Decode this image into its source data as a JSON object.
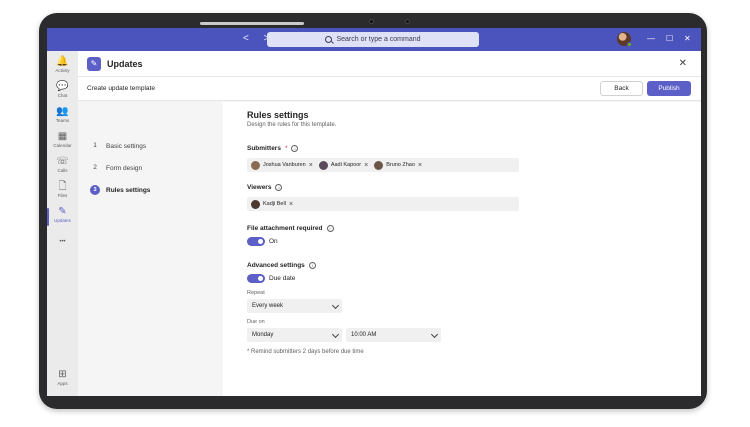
{
  "titlebar": {
    "search_placeholder": "Search or type a command",
    "nav_arrows": "< >",
    "minimize": "—",
    "maximize": "☐",
    "close": "✕"
  },
  "rail": {
    "items": [
      {
        "label": "Activity",
        "icon": "bell-icon",
        "glyph": "🔔"
      },
      {
        "label": "Chat",
        "icon": "chat-icon",
        "glyph": "💬"
      },
      {
        "label": "Teams",
        "icon": "teams-icon",
        "glyph": "👥"
      },
      {
        "label": "Calendar",
        "icon": "calendar-icon",
        "glyph": "▦"
      },
      {
        "label": "Calls",
        "icon": "phone-icon",
        "glyph": "☏"
      },
      {
        "label": "Files",
        "icon": "file-icon",
        "glyph": "🗋"
      },
      {
        "label": "Updates",
        "icon": "updates-icon",
        "glyph": "✎"
      },
      {
        "label": "",
        "icon": "more-icon",
        "glyph": "•••"
      },
      {
        "label": "Apps",
        "icon": "apps-icon",
        "glyph": "⊞"
      }
    ]
  },
  "app": {
    "title": "Updates",
    "close": "✕",
    "icon": "updates-icon"
  },
  "subheader": {
    "title": "Create update template",
    "back_label": "Back",
    "publish_label": "Publish"
  },
  "steps": [
    {
      "num": "1",
      "label": "Basic settings"
    },
    {
      "num": "2",
      "label": "Form design"
    },
    {
      "num": "3",
      "label": "Rules settings"
    }
  ],
  "main": {
    "title": "Rules settings",
    "description": "Design the rules for this template.",
    "submitters_label": "Submitters",
    "required_mark": "*",
    "submitters": [
      {
        "name": "Joshua Vanburen",
        "color": "#8a6a52"
      },
      {
        "name": "Aadi Kapoor",
        "color": "#5a4a5a"
      },
      {
        "name": "Bruno Zhao",
        "color": "#6b5548"
      }
    ],
    "viewers_label": "Viewers",
    "viewers": [
      {
        "name": "Kadji Bell",
        "color": "#4a3a30"
      }
    ],
    "file_attachment_label": "File attachment required",
    "file_attachment_state": "On",
    "advanced_label": "Advanced settings",
    "due_date_label": "Due date",
    "repeat_label": "Repeat",
    "repeat_value": "Every week",
    "due_on_label": "Due on",
    "due_day_value": "Monday",
    "due_time_value": "10:00 AM",
    "remind_note": "* Remind submitters 2 days before due time"
  },
  "colors": {
    "brand": "#5b5fc7",
    "titlebar": "#4b53bc",
    "presence": "#6bb700"
  }
}
